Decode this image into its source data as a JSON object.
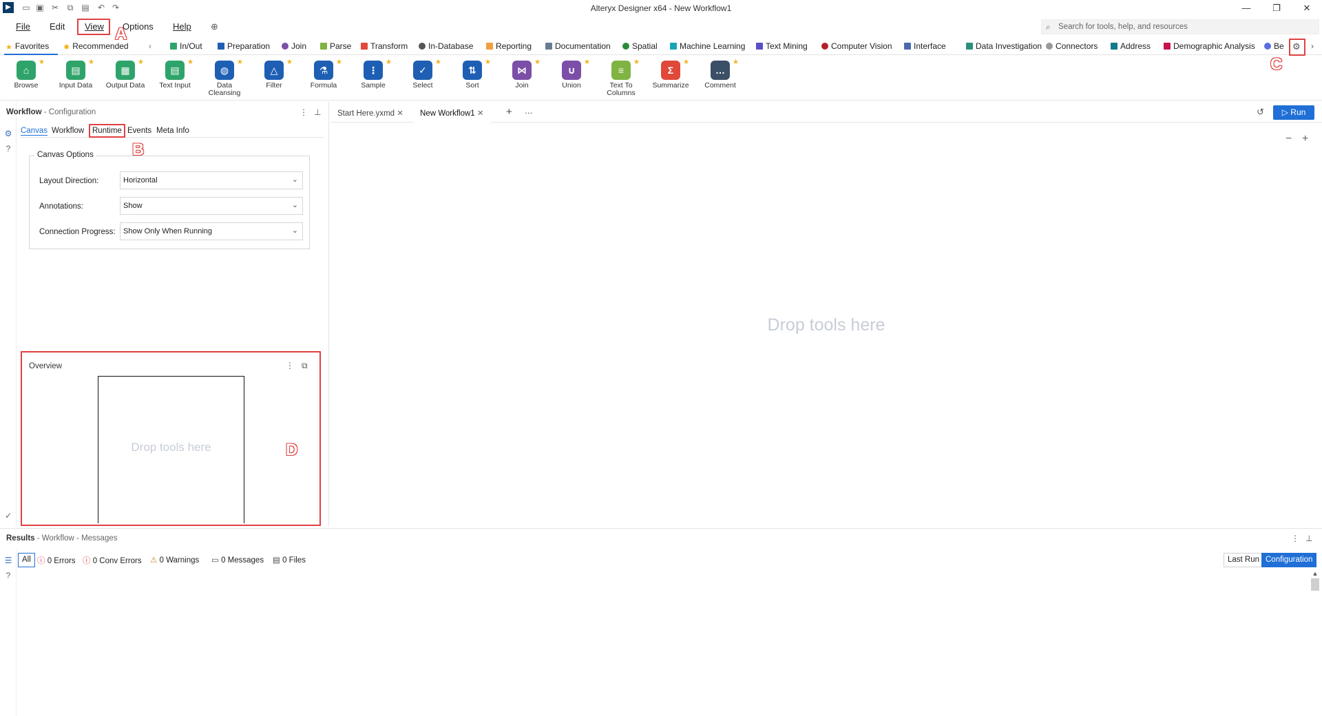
{
  "window": {
    "title": "Alteryx Designer x64 - New Workflow1"
  },
  "menu": {
    "items": [
      "File",
      "Edit",
      "View",
      "Options",
      "Help"
    ]
  },
  "search": {
    "placeholder": "Search for tools, help, and resources"
  },
  "palette_tabs": [
    {
      "label": "Favorites",
      "color": "#f3b21b"
    },
    {
      "label": "Recommended",
      "color": "#f3b21b"
    },
    {
      "label": "In/Out",
      "color": "#2fa46a"
    },
    {
      "label": "Preparation",
      "color": "#1e5fb4"
    },
    {
      "label": "Join",
      "color": "#7b4fa8"
    },
    {
      "label": "Parse",
      "color": "#7fb342"
    },
    {
      "label": "Transform",
      "color": "#e0483a"
    },
    {
      "label": "In-Database",
      "color": "#555"
    },
    {
      "label": "Reporting",
      "color": "#f0a040"
    },
    {
      "label": "Documentation",
      "color": "#6a7b93"
    },
    {
      "label": "Spatial",
      "color": "#2a8a3a"
    },
    {
      "label": "Machine Learning",
      "color": "#18a4b8"
    },
    {
      "label": "Text Mining",
      "color": "#5a4fc8"
    },
    {
      "label": "Computer Vision",
      "color": "#b2202e"
    },
    {
      "label": "Interface",
      "color": "#4b6bb0"
    },
    {
      "label": "Data Investigation",
      "color": "#2d8f7b"
    },
    {
      "label": "Connectors",
      "color": "#999"
    },
    {
      "label": "Address",
      "color": "#0f7c8c"
    },
    {
      "label": "Demographic Analysis",
      "color": "#c8154a"
    },
    {
      "label": "Be",
      "color": "#5a6ee0"
    }
  ],
  "tools": [
    {
      "label": "Browse",
      "color": "#2fa46a",
      "icon": "binoculars-icon"
    },
    {
      "label": "Input Data",
      "color": "#2fa46a",
      "icon": "book-icon"
    },
    {
      "label": "Output Data",
      "color": "#2fa46a",
      "icon": "table-icon"
    },
    {
      "label": "Text Input",
      "color": "#2fa46a",
      "icon": "book-icon"
    },
    {
      "label": "Data Cleansing",
      "color": "#1e5fb4",
      "icon": "brush-icon"
    },
    {
      "label": "Filter",
      "color": "#1e5fb4",
      "icon": "filter-icon"
    },
    {
      "label": "Formula",
      "color": "#1e5fb4",
      "icon": "flask-icon"
    },
    {
      "label": "Sample",
      "color": "#1e5fb4",
      "icon": "sample-icon"
    },
    {
      "label": "Select",
      "color": "#1e5fb4",
      "icon": "check-icon"
    },
    {
      "label": "Sort",
      "color": "#1e5fb4",
      "icon": "sort-icon"
    },
    {
      "label": "Join",
      "color": "#7b4fa8",
      "icon": "join-icon"
    },
    {
      "label": "Union",
      "color": "#7b4fa8",
      "icon": "union-icon"
    },
    {
      "label": "Text To Columns",
      "color": "#7fb342",
      "icon": "columns-icon"
    },
    {
      "label": "Summarize",
      "color": "#e0483a",
      "icon": "sigma-icon"
    },
    {
      "label": "Comment",
      "color": "#3b4f66",
      "icon": "comment-icon"
    }
  ],
  "config_panel": {
    "title": "Workflow",
    "subtitle": "- Configuration",
    "tabs": [
      "Canvas",
      "Workflow",
      "Runtime",
      "Events",
      "Meta Info"
    ],
    "group_title": "Canvas Options",
    "fields": [
      {
        "label": "Layout Direction:",
        "value": "Horizontal"
      },
      {
        "label": "Annotations:",
        "value": "Show"
      },
      {
        "label": "Connection Progress:",
        "value": "Show Only When Running"
      }
    ]
  },
  "overview": {
    "title": "Overview",
    "placeholder": "Drop tools here"
  },
  "doc_tabs": [
    {
      "label": "Start Here.yxmd"
    },
    {
      "label": "New Workflow1"
    }
  ],
  "run_label": "Run",
  "canvas": {
    "placeholder": "Drop tools here"
  },
  "results": {
    "title": "Results",
    "subtitle": "- Workflow - Messages",
    "filters": [
      "All",
      "0 Errors",
      "0 Conv Errors",
      "0 Warnings",
      "0 Messages",
      "0 Files"
    ],
    "last_run": "Last Run",
    "configuration": "Configuration"
  },
  "callouts": [
    "A",
    "B",
    "C",
    "D"
  ],
  "colors": {
    "accent": "#1f6fd6",
    "highlight": "#e04040"
  }
}
